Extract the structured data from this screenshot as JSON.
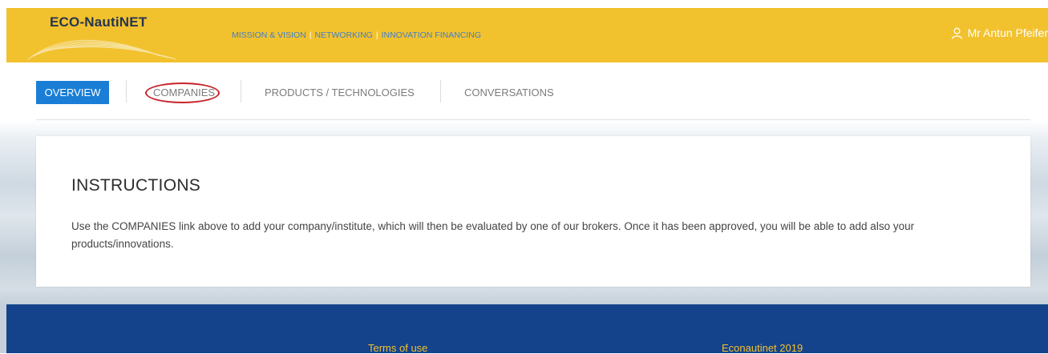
{
  "header": {
    "logo_text": "ECO-NautiNET",
    "nav": [
      "MISSION & VISION",
      "NETWORKING",
      "INNOVATION FINANCING"
    ],
    "nav_separator": "|",
    "user_name": "Mr Antun Pfeifer"
  },
  "tabs": {
    "items": [
      "OVERVIEW",
      "COMPANIES",
      "PRODUCTS / TECHNOLOGIES",
      "CONVERSATIONS"
    ],
    "active": "OVERVIEW"
  },
  "main": {
    "heading": "INSTRUCTIONS",
    "body": "Use the COMPANIES link above to add your company/institute, which will then be evaluated by one of our brokers. Once it has been approved, you will be able to add also your products/innovations."
  },
  "footer": {
    "terms": "Terms of use",
    "copyright": "Econautinet 2019"
  },
  "colors": {
    "header_bg": "#f2c12e",
    "active_tab": "#1a7ed6",
    "footer_bg": "#14438c",
    "highlight_circle": "#c8242b"
  },
  "icons": {
    "user": "user-icon"
  }
}
